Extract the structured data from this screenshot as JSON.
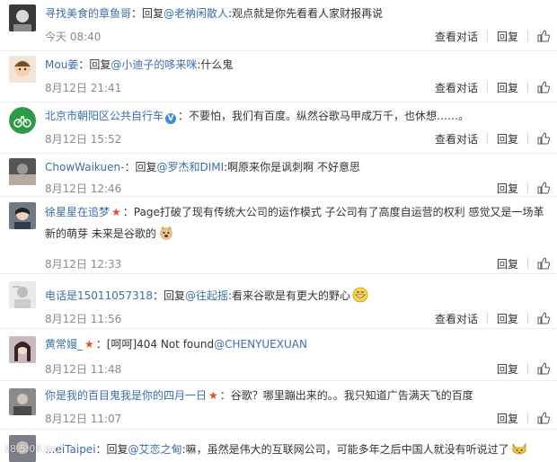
{
  "actions": {
    "view_conversation": "查看对话",
    "reply": "回复"
  },
  "comments": [
    {
      "name": "寻找美食的章鱼哥",
      "reply_prefix": "：回复",
      "mention": "@老衲闲散人",
      "text": ":观点就是你先看看人家财报再说",
      "time": "今天 08:40",
      "has_view": true
    },
    {
      "name": "Mou姜",
      "reply_prefix": "：回复",
      "mention": "@小迪子的哆来咪",
      "text": ":什么鬼",
      "time": "8月12日 21:41",
      "has_view": true
    },
    {
      "name": "北京市朝阳区公共自行车",
      "text": "：不要怕，我们有百度。纵然谷歌马甲成万千，也休想……。",
      "time": "8月12日 15:52",
      "has_view": true
    },
    {
      "name": "ChowWaikuen-",
      "reply_prefix": "：回复",
      "mention": "@罗杰和DIMI",
      "text": ":啊原来你是讽刺啊 不好意思",
      "time": "8月12日 12:46",
      "has_view": false
    },
    {
      "name": "徐星星在追梦",
      "text": "：Page打破了现有传统大公司的运作模式 子公司有了高度自运营的权利 感觉又是一场革新的萌芽 未来是谷歌的",
      "time": "8月12日 12:33",
      "has_view": false
    },
    {
      "name": "电话是15011057318",
      "reply_prefix": "：回复",
      "mention": "@往起摇",
      "text": ":看来谷歌是有更大的野心",
      "time": "8月12日 11:56",
      "has_view": true
    },
    {
      "name": "黄常嫚_",
      "text": "：[呵呵]404 Not found",
      "mention": "@CHENYUEXUAN",
      "time": "8月12日 11:48",
      "has_view": false
    },
    {
      "name": "你是我的百目鬼我是你的四月一日",
      "text": "：谷歌？哪里蹦出来的。。我只知道广告满天飞的百度",
      "time": "8月12日 11:07",
      "has_view": false
    },
    {
      "name": "...eiTaipei",
      "reply_prefix": "：回复",
      "mention": "@艾恋之甸",
      "text": ":嘛，虽然是伟大的互联网公司，可能多年之后中国人就没有听说过了",
      "time": "",
      "has_view": false
    }
  ],
  "watermark": "18.5:09.jpg",
  "colors": {
    "name": "#3c6ea8",
    "time": "#8a8a8a",
    "star": "#e24b26",
    "verified": "#3c8be0"
  }
}
